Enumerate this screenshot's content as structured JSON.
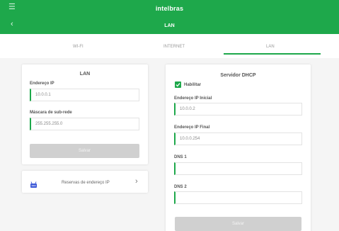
{
  "header": {
    "menu_icon": "menu-icon",
    "brand": "intelbras",
    "back_icon": "back-arrow-icon",
    "title": "LAN",
    "accent_color": "#1ea84b"
  },
  "tabs": [
    {
      "label": "WI-FI",
      "active": false
    },
    {
      "label": "INTERNET",
      "active": false
    },
    {
      "label": "LAN",
      "active": true
    }
  ],
  "lan_card": {
    "title": "LAN",
    "ip_label": "Endereço IP",
    "ip_value": "10.0.0.1",
    "mask_label": "Máscara de sub-rede",
    "mask_value": "255.255.255.0",
    "save_label": "Salvar"
  },
  "reserve": {
    "icon": "router-icon",
    "label": "Reservas de endereço IP",
    "chevron_icon": "chevron-right-icon"
  },
  "dhcp_card": {
    "title": "Servidor DHCP",
    "enable_label": "Habilitar",
    "enabled": true,
    "start_label": "Endereço IP Inicial",
    "start_value": "10.0.0.2",
    "end_label": "Endereço IP Final",
    "end_value": "10.0.0.254",
    "dns1_label": "DNS 1",
    "dns1_value": "",
    "dns2_label": "DNS 2",
    "dns2_value": "",
    "save_label": "Salvar"
  }
}
